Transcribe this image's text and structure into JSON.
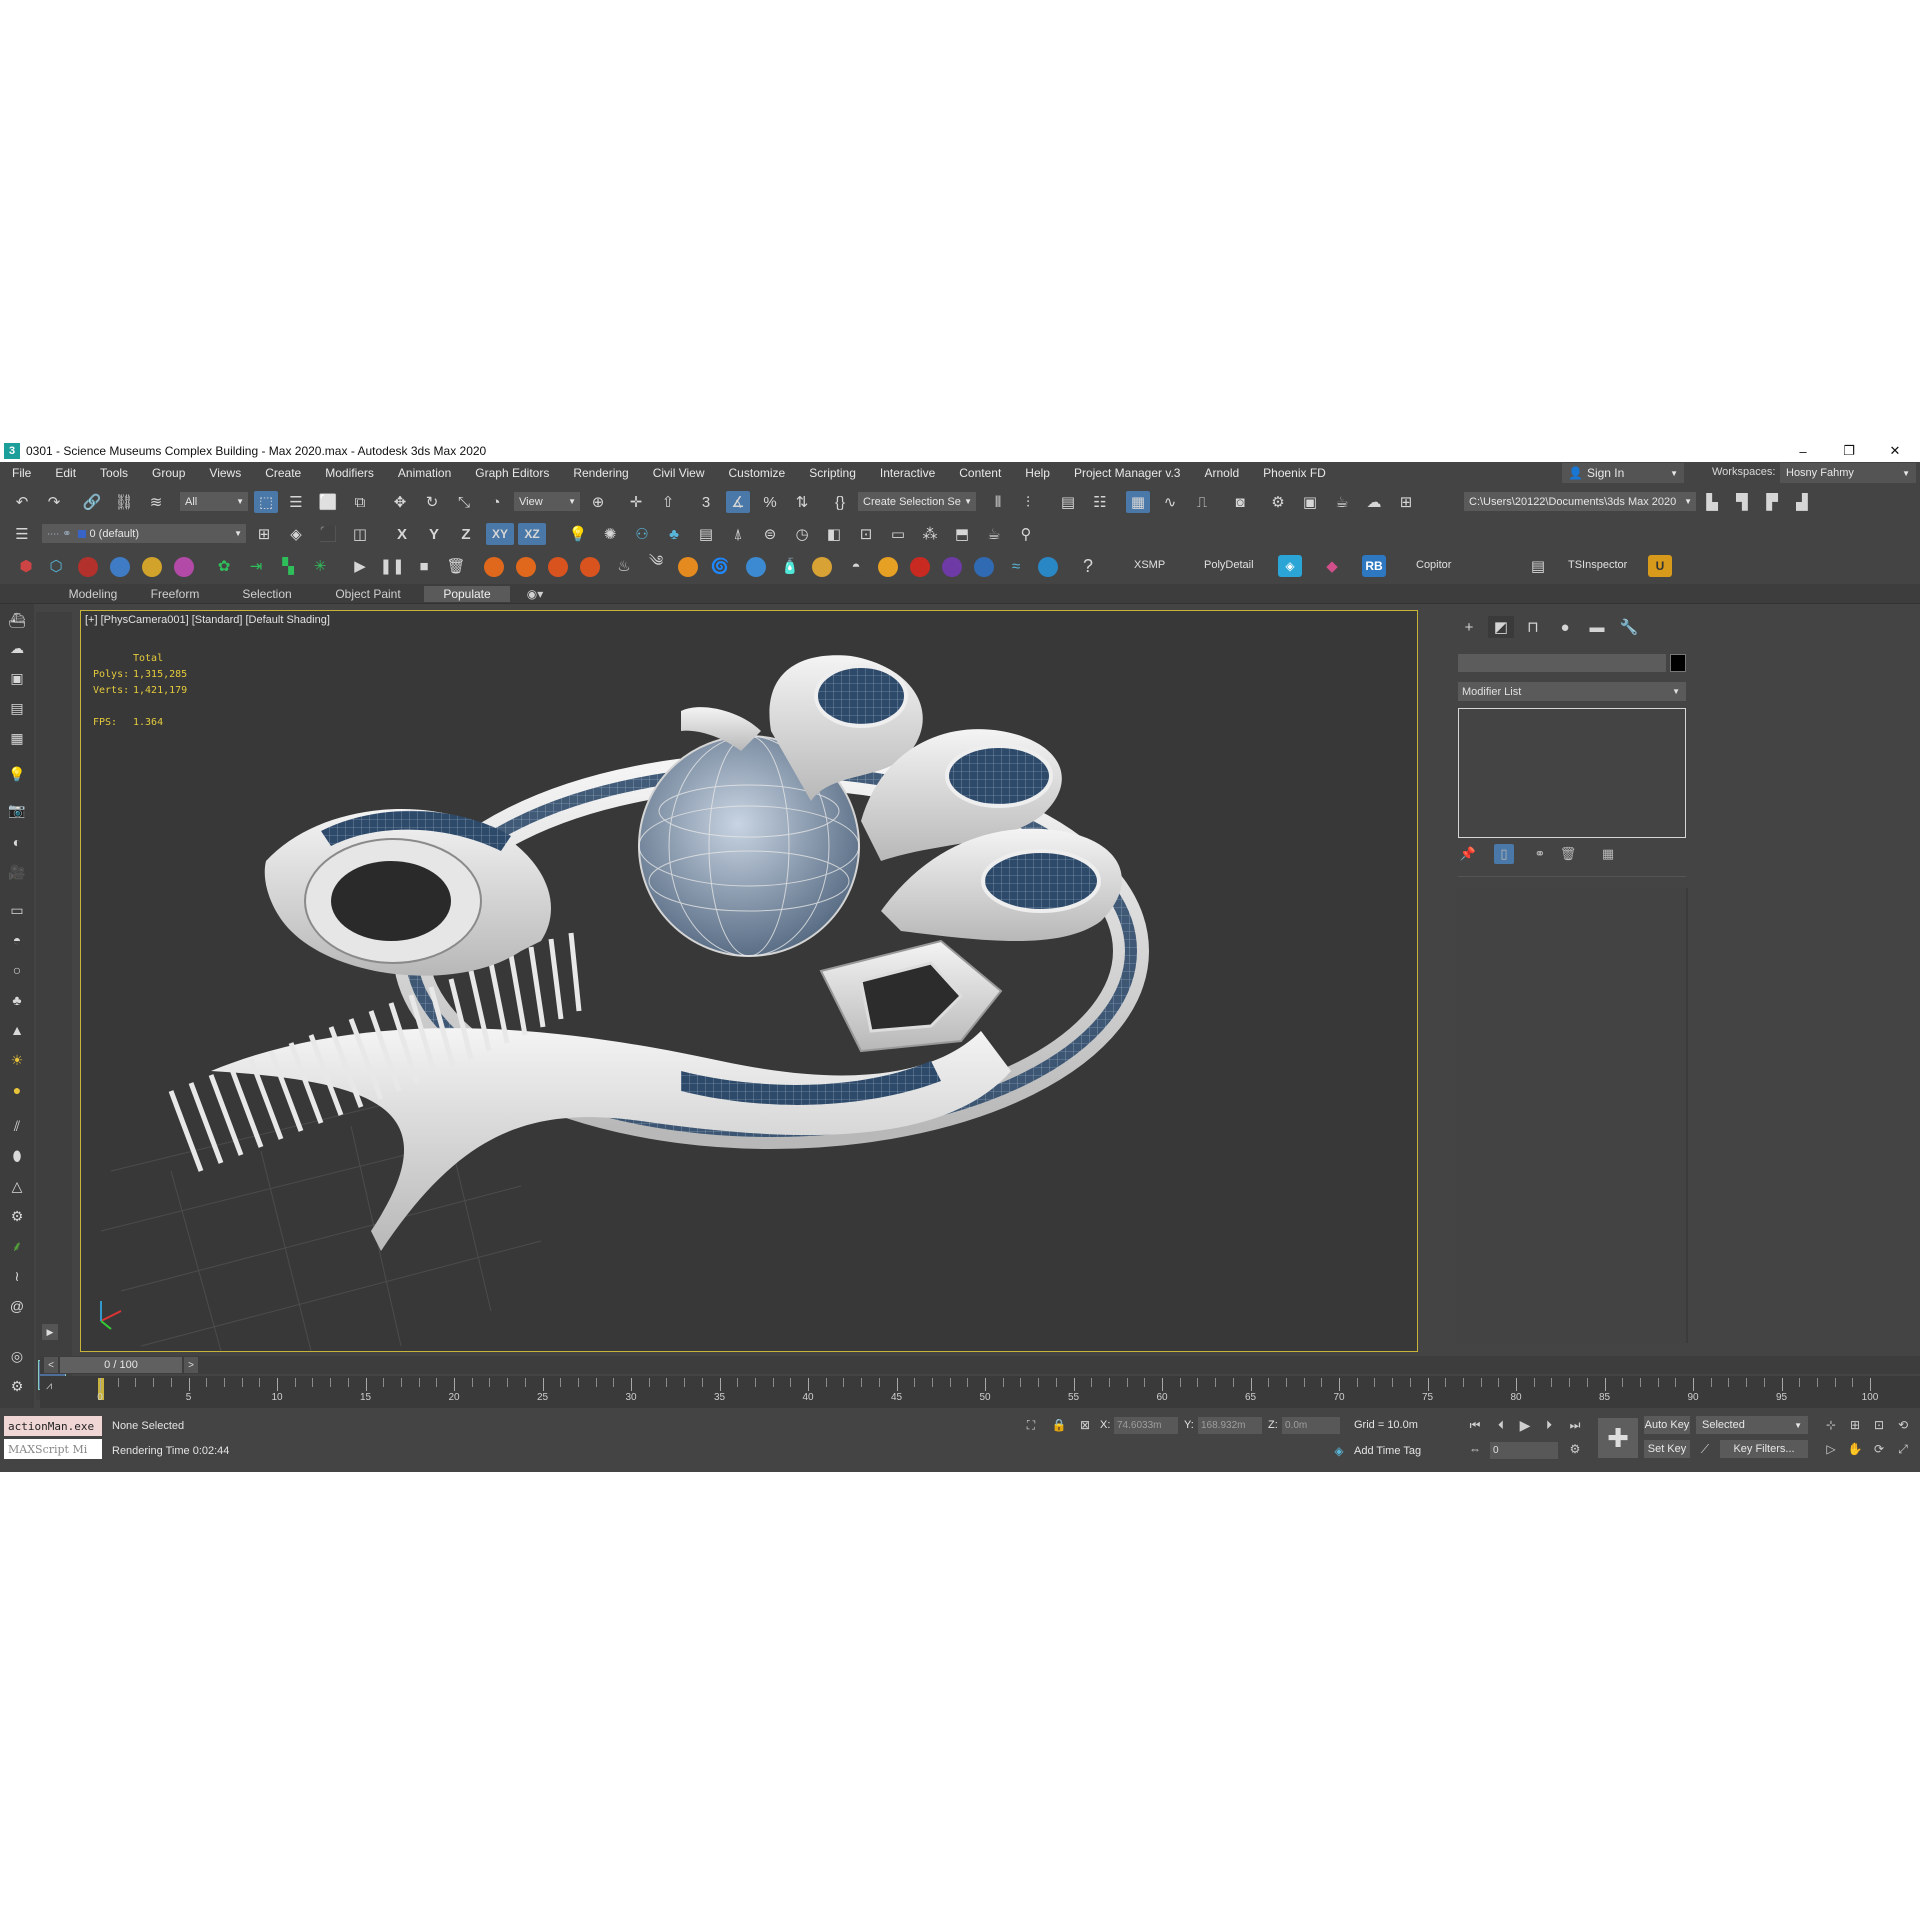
{
  "window": {
    "title": "0301 - Science Museums Complex Building - Max 2020.max - Autodesk 3ds Max 2020",
    "app_icon_glyph": "3",
    "minimize_glyph": "–",
    "restore_glyph": "❐",
    "close_glyph": "✕"
  },
  "menu": [
    "File",
    "Edit",
    "Tools",
    "Group",
    "Views",
    "Create",
    "Modifiers",
    "Animation",
    "Graph Editors",
    "Rendering",
    "Civil View",
    "Customize",
    "Scripting",
    "Interactive",
    "Content",
    "Help",
    "Project Manager v.3",
    "Arnold",
    "Phoenix FD"
  ],
  "account": {
    "sign_in": "Sign In",
    "workspaces_label": "Workspaces:",
    "workspace": "Hosny Fahmy"
  },
  "toolbar": {
    "selection_filter": "All",
    "ref_coord": "View",
    "named_selection": "Create Selection Se",
    "project_path": "C:\\Users\\20122\\Documents\\3ds Max 2020",
    "layer": "0 (default)",
    "axis_x": "X",
    "axis_y": "Y",
    "axis_z": "Z",
    "axis_xy": "XY",
    "axis_xz": "XZ",
    "plugin_labels": {
      "xsmp": "XSMP",
      "polydetail": "PolyDetail",
      "rb": "RB",
      "copitor": "Copitor",
      "tsinspector": "TSInspector"
    }
  },
  "ribbon_tabs": [
    "Modeling",
    "Freeform",
    "Selection",
    "Object Paint",
    "Populate"
  ],
  "ribbon_active": "Populate",
  "viewport": {
    "label": "[+] [PhysCamera001] [Standard] [Default Shading]",
    "stats": {
      "header": "Total",
      "polys_label": "Polys:",
      "polys": "1,315,285",
      "verts_label": "Verts:",
      "verts": "1,421,179",
      "fps_label": "FPS:",
      "fps": "1.364"
    },
    "border_color": "#c9b43a"
  },
  "command_panel": {
    "modifier_list": "Modifier List",
    "object_color": "#000000"
  },
  "time_slider": {
    "current_frame": 0,
    "label": "0 / 100",
    "prev": "<",
    "next": ">"
  },
  "track": {
    "ticks": [
      "0",
      "5",
      "10",
      "15",
      "20",
      "25",
      "30",
      "35",
      "40",
      "45",
      "50",
      "55",
      "60",
      "65",
      "70",
      "75",
      "80",
      "85",
      "90",
      "95",
      "100"
    ]
  },
  "status": {
    "maxscript_line1": "actionMan.exe",
    "maxscript_line2": "MAXScript Mi",
    "selection": "None Selected",
    "render_time": "Rendering Time  0:02:44",
    "x_label": "X:",
    "x": "74.6033m",
    "y_label": "Y:",
    "y": "168.932m",
    "z_label": "Z:",
    "z": "0.0m",
    "grid": "Grid = 10.0m",
    "add_time_tag": "Add Time Tag",
    "frame": "0",
    "auto_key": "Auto Key",
    "set_key": "Set Key",
    "selected": "Selected",
    "key_filters": "Key Filters..."
  }
}
